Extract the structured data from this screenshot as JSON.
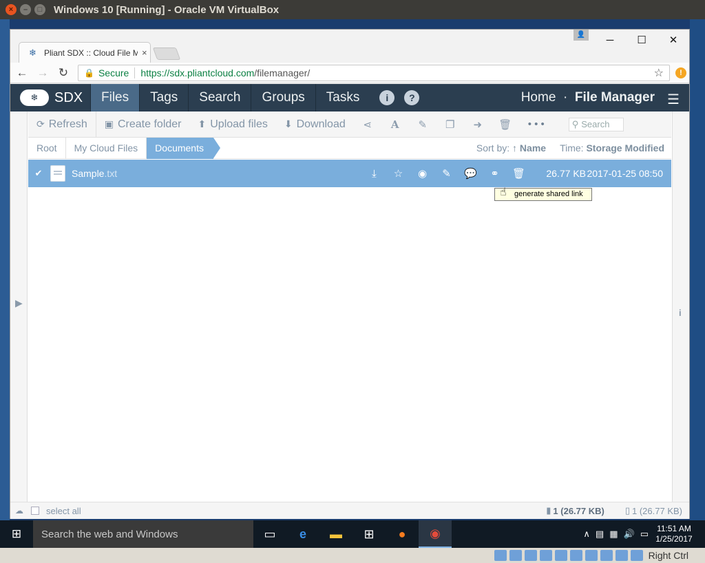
{
  "host": {
    "title": "Windows 10 [Running] - Oracle VM VirtualBox",
    "btn_close": "×",
    "btn_min": "–",
    "btn_max": "□"
  },
  "browser": {
    "tab_title": "Pliant SDX :: Cloud File M",
    "tab_close": "×",
    "secure_label": "Secure",
    "url_host": "https://sdx.pliantcloud.com",
    "url_path": "/filemanager/",
    "win_min": "─",
    "win_max": "☐",
    "win_close": "✕"
  },
  "app": {
    "logo_text": "SDX",
    "nav": [
      "Files",
      "Tags",
      "Search",
      "Groups",
      "Tasks"
    ],
    "crumb_home": "Home",
    "crumb_dot": "·",
    "crumb_current": "File Manager"
  },
  "actions": {
    "refresh": "Refresh",
    "create_folder": "Create folder",
    "upload": "Upload files",
    "download": "Download",
    "more": "• • •",
    "search_placeholder": "Search"
  },
  "breadcrumb": {
    "items": [
      "Root",
      "My Cloud Files",
      "Documents"
    ],
    "sort_label": "Sort by:",
    "sort_value": "↑ Name",
    "time_label": "Time:",
    "time_value": "Storage Modified"
  },
  "file": {
    "name": "Sample",
    "ext": ".txt",
    "size": "26.77 KB",
    "modified": "2017-01-25 08:50"
  },
  "tooltip": {
    "text": "generate shared link"
  },
  "status": {
    "select_all": "select all",
    "selected": "1 (26.77 KB)",
    "total": "1 (26.77 KB)"
  },
  "taskbar": {
    "search_placeholder": "Search the web and Windows",
    "time": "11:51 AM",
    "date": "1/25/2017"
  },
  "vbox": {
    "host_key": "Right Ctrl"
  }
}
